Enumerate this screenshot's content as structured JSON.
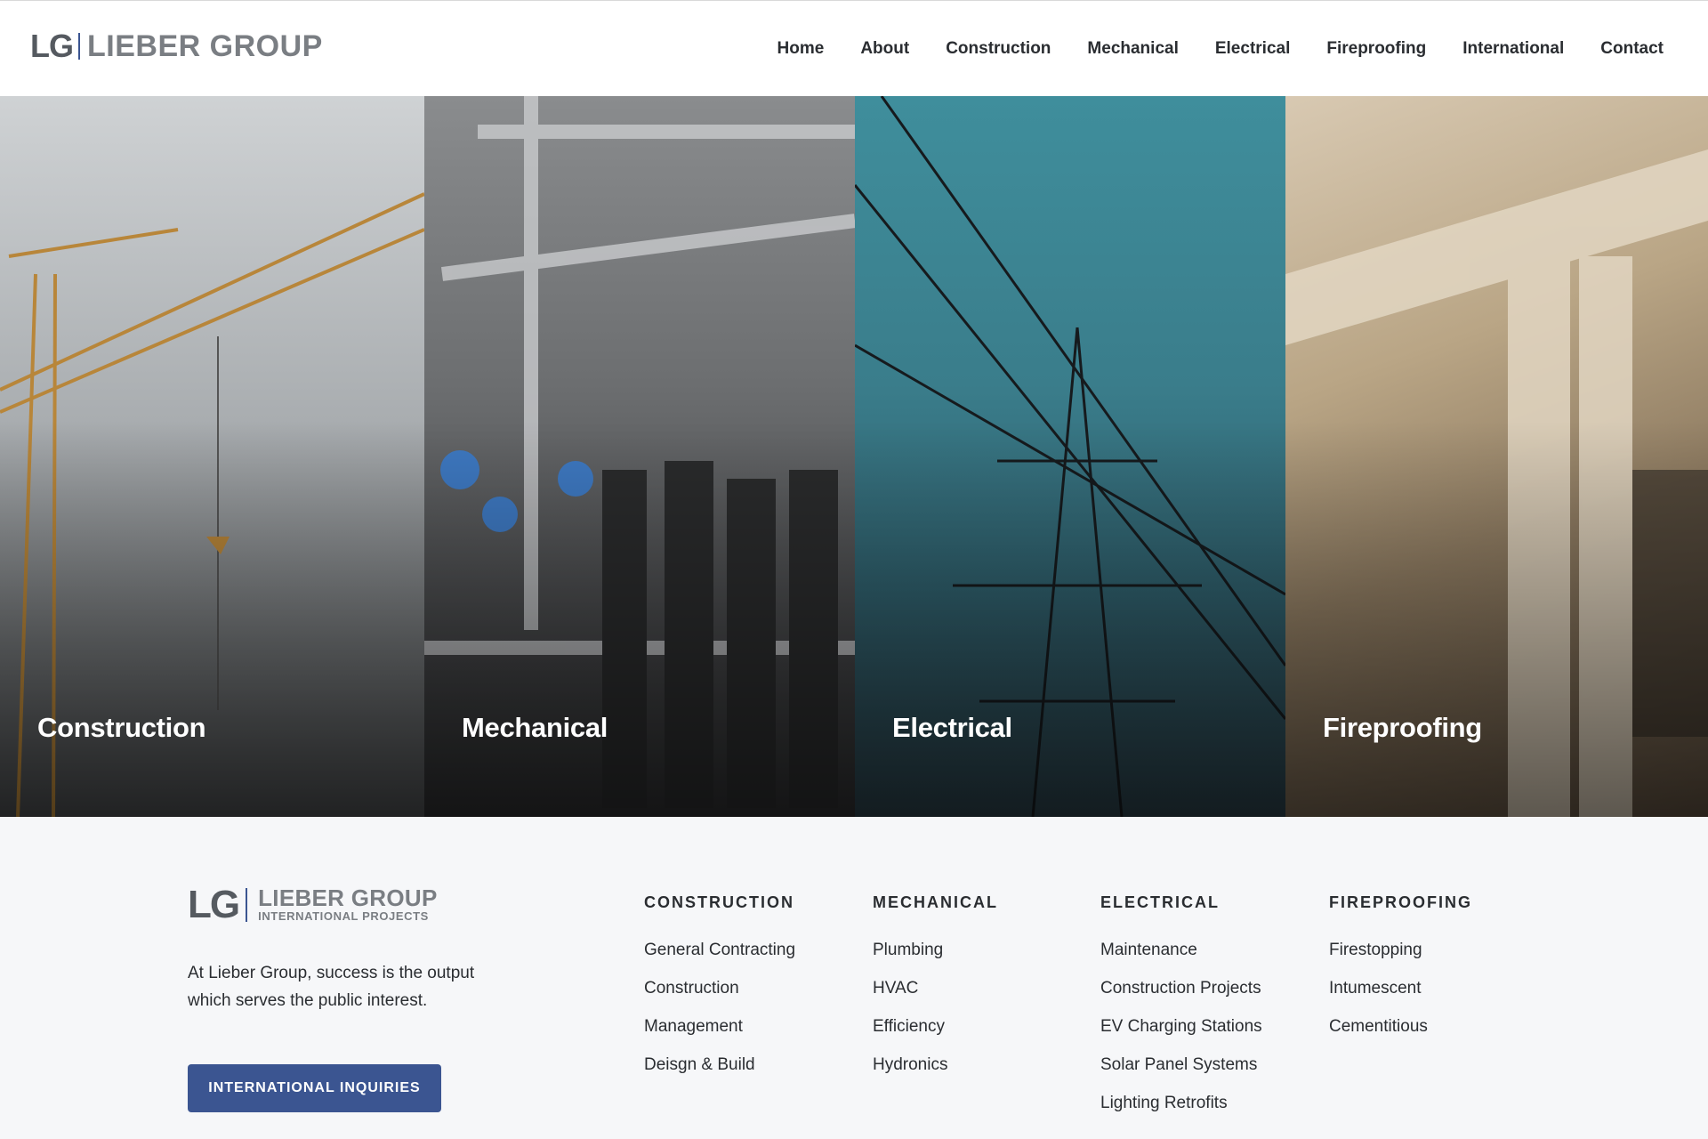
{
  "header": {
    "logo_mono": "LG",
    "logo_name": "LIEBER GROUP",
    "nav": [
      "Home",
      "About",
      "Construction",
      "Mechanical",
      "Electrical",
      "Fireproofing",
      "International",
      "Contact"
    ]
  },
  "panels": [
    {
      "label": "Construction"
    },
    {
      "label": "Mechanical"
    },
    {
      "label": "Electrical"
    },
    {
      "label": "Fireproofing"
    }
  ],
  "footer": {
    "logo_mono": "LG",
    "logo_name": "LIEBER GROUP",
    "logo_sub": "INTERNATIONAL PROJECTS",
    "tagline": "At Lieber Group, success is the output which serves the public interest.",
    "cta": "INTERNATIONAL INQUIRIES",
    "columns": [
      {
        "title": "CONSTRUCTION",
        "items": [
          "General Contracting",
          "Construction",
          "Management",
          "Deisgn & Build"
        ]
      },
      {
        "title": "MECHANICAL",
        "items": [
          "Plumbing",
          "HVAC",
          "Efficiency",
          "Hydronics"
        ]
      },
      {
        "title": "ELECTRICAL",
        "items": [
          "Maintenance",
          "Construction Projects",
          "EV Charging Stations",
          "Solar Panel Systems",
          "Lighting Retrofits"
        ]
      },
      {
        "title": "FIREPROOFING",
        "items": [
          "Firestopping",
          "Intumescent",
          "Cementitious"
        ]
      }
    ]
  },
  "colors": {
    "accent": "#3b5591",
    "logo_gray": "#7a7e83",
    "text": "#2a2d31",
    "footer_bg": "#f6f7f9"
  }
}
